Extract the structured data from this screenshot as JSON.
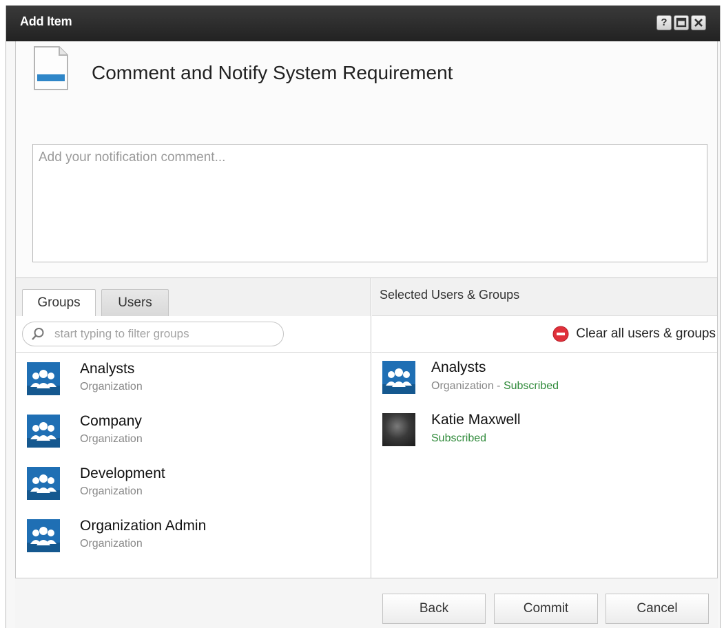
{
  "window": {
    "title": "Add Item",
    "help_label": "?",
    "maximize_label": "□",
    "close_label": "×"
  },
  "item": {
    "title": "Comment and Notify System Requirement"
  },
  "comment": {
    "placeholder": "Add your notification comment..."
  },
  "left_panel": {
    "tabs": [
      {
        "label": "Groups",
        "active": true
      },
      {
        "label": "Users",
        "active": false
      }
    ],
    "filter_placeholder": "start typing to filter groups",
    "groups": [
      {
        "name": "Analysts",
        "type": "Organization"
      },
      {
        "name": "Company",
        "type": "Organization"
      },
      {
        "name": "Development",
        "type": "Organization"
      },
      {
        "name": "Organization Admin",
        "type": "Organization"
      }
    ]
  },
  "right_panel": {
    "title": "Selected Users & Groups",
    "clear_label": "Clear all users & groups",
    "selected": [
      {
        "name": "Analysts",
        "type_prefix": "Organization - ",
        "status": "Subscribed",
        "kind": "group"
      },
      {
        "name": "Katie Maxwell",
        "type_prefix": "",
        "status": "Subscribed",
        "kind": "user"
      }
    ]
  },
  "footer": {
    "back_label": "Back",
    "commit_label": "Commit",
    "cancel_label": "Cancel"
  },
  "colors": {
    "titlebar": "#2b2b2b",
    "group_icon_blue": "#1f6fb4",
    "subscribed_green": "#2f8a3a",
    "clear_icon_red": "#e0303a"
  },
  "icons": {
    "document": "document-icon",
    "group": "people-group-icon",
    "search": "search-icon",
    "clear": "minus-circle-icon"
  }
}
